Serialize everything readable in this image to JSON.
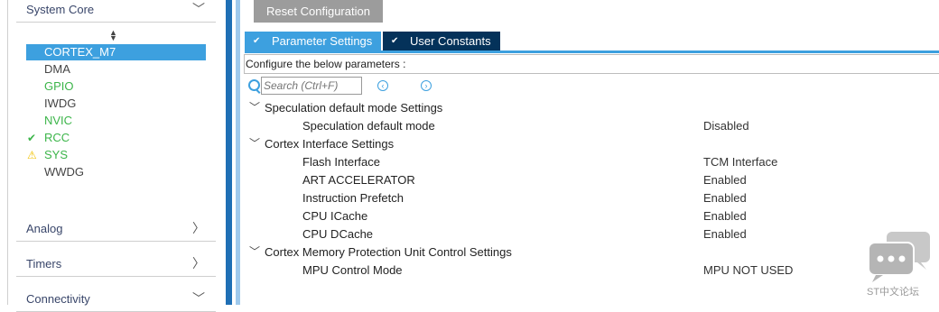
{
  "left_panel": {
    "categories": [
      {
        "label": "System Core",
        "chevron": "﹀"
      },
      {
        "label": "Analog",
        "chevron": "〉"
      },
      {
        "label": "Timers",
        "chevron": "〉"
      },
      {
        "label": "Connectivity",
        "chevron": "﹀"
      }
    ],
    "components": [
      {
        "label": "CORTEX_M7",
        "status": "selected",
        "icon": ""
      },
      {
        "label": "DMA",
        "status": "none",
        "icon": ""
      },
      {
        "label": "GPIO",
        "status": "configured",
        "icon": ""
      },
      {
        "label": "IWDG",
        "status": "none",
        "icon": ""
      },
      {
        "label": "NVIC",
        "status": "configured",
        "icon": ""
      },
      {
        "label": "RCC",
        "status": "ok",
        "icon": "✔"
      },
      {
        "label": "SYS",
        "status": "warning",
        "icon": "⚠"
      },
      {
        "label": "WWDG",
        "status": "none",
        "icon": ""
      }
    ]
  },
  "toolbar": {
    "reset_label": "Reset Configuration"
  },
  "tabs": [
    {
      "label": "Parameter Settings",
      "icon": "check-circle"
    },
    {
      "label": "User Constants",
      "icon": "check-circle"
    }
  ],
  "description": "Configure the below parameters :",
  "search": {
    "placeholder": "Search (Ctrl+F)"
  },
  "groups": [
    {
      "label": "Speculation default mode Settings",
      "params": [
        {
          "name": "Speculation default mode",
          "value": "Disabled"
        }
      ]
    },
    {
      "label": "Cortex Interface Settings",
      "params": [
        {
          "name": "Flash Interface",
          "value": "TCM Interface"
        },
        {
          "name": "ART ACCELERATOR",
          "value": "Enabled"
        },
        {
          "name": "Instruction Prefetch",
          "value": "Enabled"
        },
        {
          "name": "CPU ICache",
          "value": "Enabled"
        },
        {
          "name": "CPU DCache",
          "value": "Enabled"
        }
      ]
    },
    {
      "label": "Cortex Memory Protection Unit Control Settings",
      "params": [
        {
          "name": "MPU Control Mode",
          "value": "MPU NOT USED"
        }
      ]
    }
  ],
  "watermark": {
    "text": "ST中文论坛"
  },
  "colors": {
    "accent": "#3da0df",
    "dark_tab": "#04325a",
    "green": "#3cb54a",
    "warning": "#f2c200"
  }
}
